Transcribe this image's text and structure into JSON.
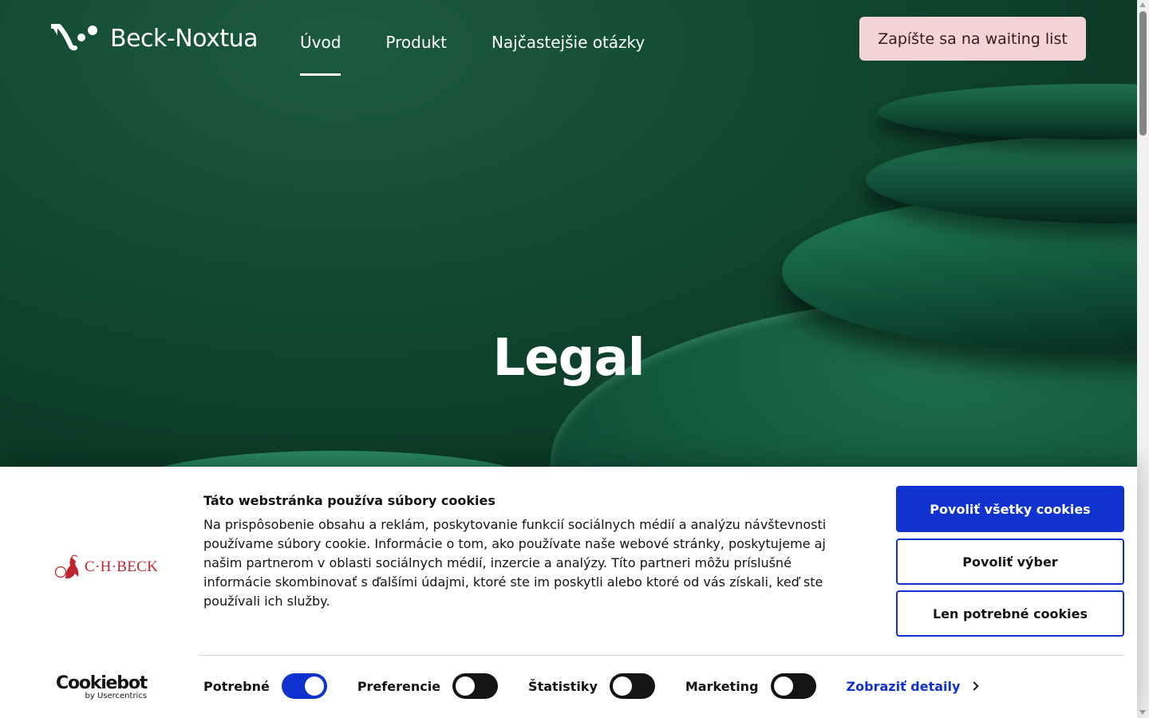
{
  "header": {
    "brand": "Beck-Noxtua",
    "nav": [
      {
        "label": "Úvod",
        "active": true
      },
      {
        "label": "Produkt",
        "active": false
      },
      {
        "label": "Najčastejšie otázky",
        "active": false
      }
    ],
    "cta": "Zapíšte sa na waiting list"
  },
  "hero": {
    "title": "Legal"
  },
  "cookie_banner": {
    "publisher_logo_text": "C·H·BECK",
    "title": "Táto webstránka používa súbory cookies",
    "text": "Na prispôsobenie obsahu a reklám, poskytovanie funkcií sociálnych médií a analýzu návštevnosti používame súbory cookie. Informácie o tom, ako používate naše webové stránky, poskytujeme aj našim partnerom v oblasti sociálnych médií, inzercie a analýzy. Títo partneri môžu príslušné informácie skombinovať s ďalšími údajmi, ktoré ste im poskytli alebo ktoré od vás získali, keď ste používali ich služby.",
    "buttons": {
      "allow_all": "Povoliť všetky cookies",
      "allow_selection": "Povoliť výber",
      "necessary_only": "Len potrebné cookies"
    },
    "toggles": [
      {
        "label": "Potrebné",
        "on": true
      },
      {
        "label": "Preferencie",
        "on": false
      },
      {
        "label": "Štatistiky",
        "on": false
      },
      {
        "label": "Marketing",
        "on": false
      }
    ],
    "details_link": "Zobraziť detaily",
    "cookiebot": {
      "name": "Cookiebot",
      "by": "by Usercentrics"
    }
  },
  "colors": {
    "hero_green": "#124a33",
    "cta_pink": "#f3d3d3",
    "primary_blue": "#1032cf",
    "chbeck_red": "#c0262d"
  }
}
